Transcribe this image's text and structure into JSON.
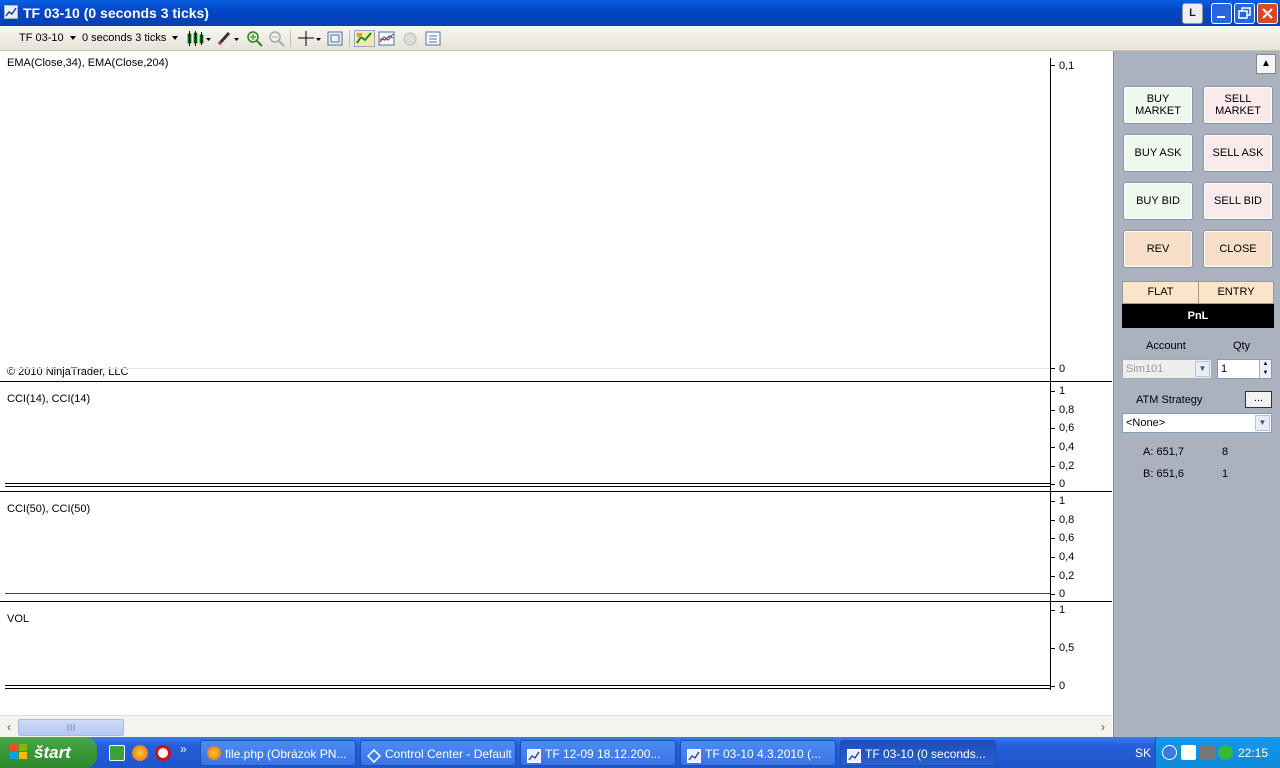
{
  "window": {
    "title": "TF 03-10   (0 seconds 3 ticks)",
    "btn_l": "L"
  },
  "toolbar": {
    "instrument": "TF 03-10",
    "period": "0 seconds 3 ticks"
  },
  "chart": {
    "panels": [
      {
        "label": "EMA(Close,34), EMA(Close,204)",
        "ticks": [
          "0,1",
          "0"
        ]
      },
      {
        "label": "CCI(14), CCI(14)",
        "ticks": [
          "1",
          "0,8",
          "0,6",
          "0,4",
          "0,2",
          "0"
        ]
      },
      {
        "label": "CCI(50), CCI(50)",
        "ticks": [
          "1",
          "0,8",
          "0,6",
          "0,4",
          "0,2",
          "0"
        ]
      },
      {
        "label": "VOL",
        "ticks": [
          "1",
          "0,5",
          "0"
        ]
      }
    ],
    "copyright": "© 2010 NinjaTrader, LLC"
  },
  "order_panel": {
    "buttons": {
      "buy_market": "BUY MARKET",
      "sell_market": "SELL MARKET",
      "buy_ask": "BUY ASK",
      "sell_ask": "SELL ASK",
      "buy_bid": "BUY BID",
      "sell_bid": "SELL BID",
      "rev": "REV",
      "close": "CLOSE"
    },
    "position": "FLAT",
    "entry": "ENTRY",
    "pnl": "PnL",
    "account_label": "Account",
    "qty_label": "Qty",
    "account": "Sim101",
    "qty": "1",
    "atm_label": "ATM Strategy",
    "atm_button": "...",
    "atm_value": "<None>",
    "ask_label": "A: 651,7",
    "ask_size": "8",
    "bid_label": "B: 651,6",
    "bid_size": "1"
  },
  "taskbar": {
    "start": "štart",
    "tasks": [
      "file.php (Obrázok PN...",
      "Control Center - Default",
      "TF 12-09  18.12.200...",
      "TF 03-10  4.3.2010 (...",
      "TF 03-10   (0 seconds..."
    ],
    "lang": "SK",
    "clock": "22:15"
  }
}
